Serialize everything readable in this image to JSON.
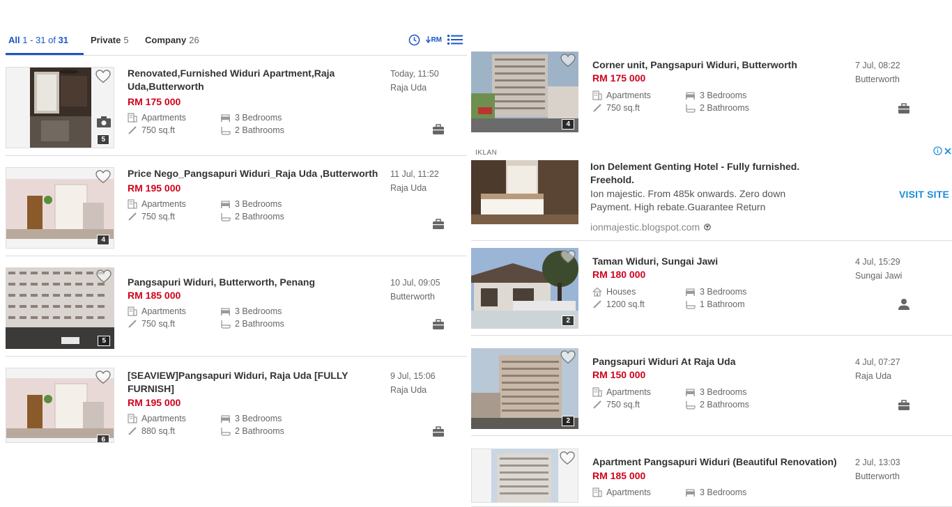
{
  "tabs": {
    "all": {
      "label": "All",
      "range": "1 - 31 of",
      "total": "31"
    },
    "private": {
      "label": "Private",
      "count": "5"
    },
    "company": {
      "label": "Company",
      "count": "26"
    },
    "sort_rm_label": "RM"
  },
  "left_listings": [
    {
      "title": "Renovated,Furnished Widuri Apartment,Raja Uda,Butterworth",
      "price": "RM 175 000",
      "type": "Apartments",
      "size": "750 sq.ft",
      "bedrooms": "3 Bedrooms",
      "bathrooms": "2 Bathrooms",
      "date": "Today, 11:50",
      "location": "Raja Uda",
      "photos": "5",
      "seller": "company"
    },
    {
      "title": "Price Nego_Pangsapuri Widuri_Raja Uda ,Butterworth",
      "price": "RM 195 000",
      "type": "Apartments",
      "size": "750 sq.ft",
      "bedrooms": "3 Bedrooms",
      "bathrooms": "2 Bathrooms",
      "date": "11 Jul, 11:22",
      "location": "Raja Uda",
      "photos": "4",
      "seller": "company"
    },
    {
      "title": "Pangsapuri Widuri, Butterworth, Penang",
      "price": "RM 185 000",
      "type": "Apartments",
      "size": "750 sq.ft",
      "bedrooms": "3 Bedrooms",
      "bathrooms": "2 Bathrooms",
      "date": "10 Jul, 09:05",
      "location": "Butterworth",
      "photos": "5",
      "seller": "company"
    },
    {
      "title": "[SEAVIEW]Pangsapuri Widuri, Raja Uda [FULLY FURNISH]",
      "price": "RM 195 000",
      "type": "Apartments",
      "size": "880 sq.ft",
      "bedrooms": "3 Bedrooms",
      "bathrooms": "2 Bathrooms",
      "date": "9 Jul, 15:06",
      "location": "Raja Uda",
      "photos": "6",
      "seller": "company"
    }
  ],
  "right_listings": [
    {
      "title": "Corner unit, Pangsapuri Widuri, Butterworth",
      "price": "RM 175 000",
      "type": "Apartments",
      "size": "750 sq.ft",
      "bedrooms": "3 Bedrooms",
      "bathrooms": "2 Bathrooms",
      "date": "7 Jul, 08:22",
      "location": "Butterworth",
      "photos": "4",
      "seller": "company"
    },
    {
      "title": "Taman Widuri, Sungai Jawi",
      "price": "RM 180 000",
      "type": "Houses",
      "size": "1200 sq.ft",
      "bedrooms": "3 Bedrooms",
      "bathrooms": "1 Bathroom",
      "date": "4 Jul, 15:29",
      "location": "Sungai Jawi",
      "photos": "2",
      "seller": "private"
    },
    {
      "title": "Pangsapuri Widuri At Raja Uda",
      "price": "RM 150 000",
      "type": "Apartments",
      "size": "750 sq.ft",
      "bedrooms": "3 Bedrooms",
      "bathrooms": "2 Bathrooms",
      "date": "4 Jul, 07:27",
      "location": "Raja Uda",
      "photos": "2",
      "seller": "company"
    },
    {
      "title": "Apartment Pangsapuri Widuri (Beautiful Renovation)",
      "price": "RM 185 000",
      "type": "Apartments",
      "size": "",
      "bedrooms": "3 Bedrooms",
      "bathrooms": "",
      "date": "2 Jul, 13:03",
      "location": "Butterworth",
      "photos": "",
      "seller": "company"
    }
  ],
  "ad": {
    "label": "IKLAN",
    "title": "Ion Delement Genting Hotel - Fully furnished. Freehold.",
    "description": "Ion majestic. From 485k onwards. Zero down Payment. High rebate.Guarantee Return",
    "domain": "ionmajestic.blogspot.com",
    "cta": "VISIT SITE"
  },
  "colors": {
    "accent": "#1a56c5",
    "price": "#d0021b",
    "ad_cta": "#1a8cd8"
  }
}
